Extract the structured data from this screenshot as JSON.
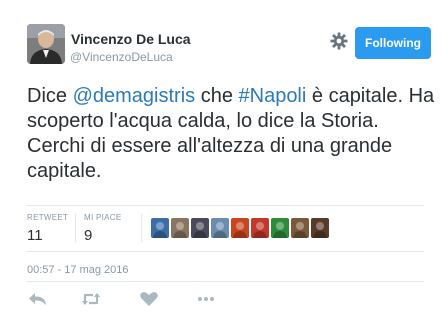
{
  "user": {
    "name": "Vincenzo De Luca",
    "handle": "@VincenzoDeLuca"
  },
  "follow_button": {
    "label": "Following"
  },
  "tweet": {
    "segments": [
      {
        "text": "Dice ",
        "kind": "plain"
      },
      {
        "text": "@demagistris",
        "kind": "mention"
      },
      {
        "text": " che ",
        "kind": "plain"
      },
      {
        "text": "#Napoli",
        "kind": "hashtag"
      },
      {
        "text": " è capitale. Ha scoperto l'acqua calda, lo dice la Storia. Cerchi di essere all'altezza di una grande capitale.",
        "kind": "plain"
      }
    ]
  },
  "stats": {
    "retweets": {
      "label": "RETWEET",
      "value": "11"
    },
    "likes": {
      "label": "MI PIACE",
      "value": "9"
    }
  },
  "likers": [
    {
      "icon": "liker-avatar-1",
      "color": "#3a6ea5"
    },
    {
      "icon": "liker-avatar-2",
      "color": "#8a7560"
    },
    {
      "icon": "liker-avatar-3",
      "color": "#4a4a5a"
    },
    {
      "icon": "liker-avatar-4",
      "color": "#6b8caf"
    },
    {
      "icon": "liker-avatar-5",
      "color": "#c9451f"
    },
    {
      "icon": "liker-avatar-6",
      "color": "#c0392b"
    },
    {
      "icon": "liker-avatar-7",
      "color": "#2e8b3a"
    },
    {
      "icon": "liker-avatar-8",
      "color": "#7a5a3a"
    },
    {
      "icon": "liker-avatar-9",
      "color": "#5a3a2a"
    }
  ],
  "timestamp": "00:57 - 17 mag 2016",
  "colors": {
    "accent": "#2b9bf0",
    "link": "#2b7bb9",
    "muted": "#8899a6"
  }
}
